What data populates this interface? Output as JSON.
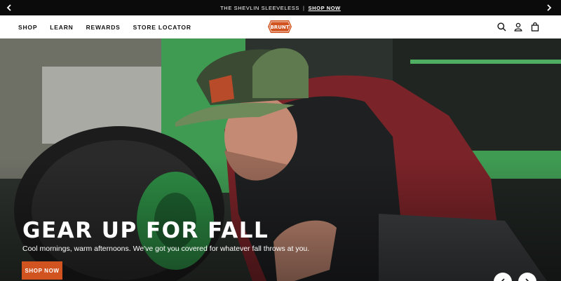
{
  "announcement": {
    "text": "THE SHEVLIN SLEEVELESS",
    "separator": "|",
    "cta": "SHOP NOW",
    "prev_icon": "chevron-left-icon",
    "next_icon": "chevron-right-icon"
  },
  "header": {
    "nav": [
      "SHOP",
      "LEARN",
      "REWARDS",
      "STORE LOCATOR"
    ],
    "logo_text": "BRUNT",
    "icons": [
      "search-icon",
      "account-icon",
      "cart-icon"
    ]
  },
  "hero": {
    "title": "GEAR UP FOR FALL",
    "subtitle": "Cool mornings, warm afternoons. We've got you covered for whatever fall throws at you.",
    "button": "SHOP NOW",
    "prev_icon": "chevron-left-icon",
    "next_icon": "chevron-right-icon"
  },
  "colors": {
    "accent": "#d1531f",
    "announcement_bg": "#0b0b0b",
    "header_bg": "#ffffff"
  }
}
